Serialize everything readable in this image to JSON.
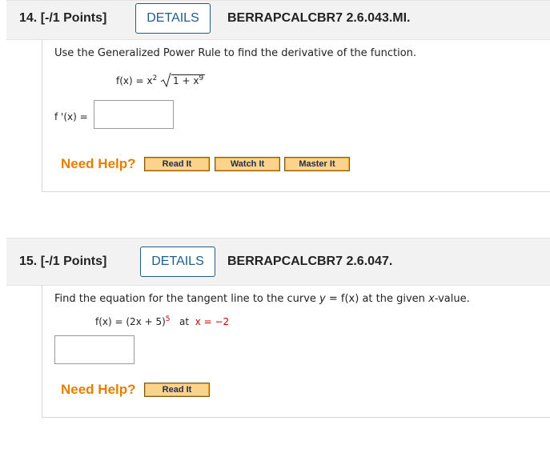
{
  "q14": {
    "number": "14. [-/1 Points]",
    "details_label": "DETAILS",
    "code": "BERRAPCALCBR7 2.6.043.MI.",
    "prompt": "Use the Generalized Power Rule to find the derivative of the function.",
    "function_lhs": "f(x) = x",
    "function_exp": "2",
    "radicand_base": "1 + x",
    "radicand_exp": "9",
    "answer_label": "f '(x)  =",
    "answer_value": "",
    "need_help": "Need Help?",
    "help_buttons": [
      "Read It",
      "Watch It",
      "Master It"
    ]
  },
  "q15": {
    "number": "15. [-/1 Points]",
    "details_label": "DETAILS",
    "code": "BERRAPCALCBR7 2.6.047.",
    "prompt_parts": [
      "Find the equation for the tangent line to the curve ",
      "y",
      " = ",
      "f(x)",
      " at the given ",
      "x",
      "-value."
    ],
    "function_lhs": "f(x) = (2x + 5)",
    "function_exp": "5",
    "at_text": "at",
    "x_value_text": "x = −2",
    "answer_value": "",
    "need_help": "Need Help?",
    "help_buttons": [
      "Read It"
    ]
  },
  "colors": {
    "details_border": "#1f5d8a",
    "need_help": "#e67e00",
    "button_fill": "#fbd38d",
    "red_value": "#cc0000"
  }
}
